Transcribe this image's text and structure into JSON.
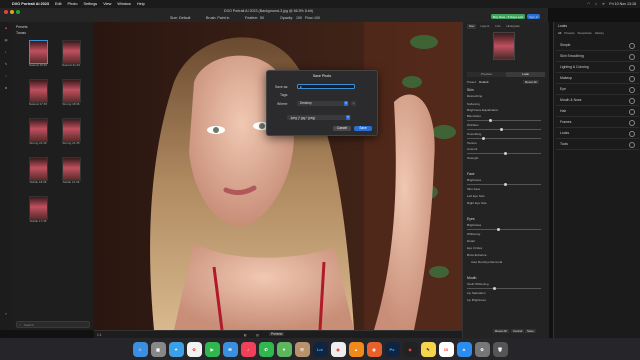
{
  "menubar": {
    "app": "DXO Portrait AI 2023",
    "items": [
      "Edit",
      "Photo",
      "Settings",
      "View",
      "Window",
      "Help"
    ],
    "clock": "Fri 10 Nov 13:18"
  },
  "toolbar": {
    "window_title": "DXO Portrait AI 2023 (Background-3.jpg @ 66.5% 8-bit)",
    "size_label": "Size: Default",
    "brush_label": "Brush: Paint in",
    "feather_label": "Feather:",
    "feather_value": "50",
    "opacity_label": "Opacity:",
    "opacity_value": "100",
    "flow_label": "Flow:",
    "flow_value": "100",
    "buy_label": "Buy Now - 5 Days Left",
    "signin_label": "Sign In"
  },
  "browser": {
    "folder_label": "Presets",
    "subfolder_label": "Tomas",
    "thumbs": [
      {
        "label": "Natural 15:36"
      },
      {
        "label": "Natural 21:46"
      },
      {
        "label": "Natural 17:45"
      },
      {
        "label": "Strong 18:36"
      },
      {
        "label": "Strong 21:46"
      },
      {
        "label": "Strong 21:45"
      },
      {
        "label": "Subtle 18:36"
      },
      {
        "label": "Subtle 21:46"
      },
      {
        "label": "Subtle 17:45"
      }
    ],
    "search_placeholder": "Search"
  },
  "dialog": {
    "title": "Save Photo",
    "save_as_label": "Save as:",
    "save_as_value": "c",
    "tags_label": "Tags:",
    "where_label": "Where:",
    "where_value": "Desktop",
    "format_value": "Jpeg (*.jpg,*.jpeg)",
    "cancel_label": "Cancel",
    "save_label": "Save"
  },
  "right_panel": {
    "tabs": [
      "Nav",
      "Layers",
      "Info",
      "Histogram"
    ],
    "mode_tabs": [
      "Preview",
      "Look"
    ],
    "preset_label": "Preset:",
    "preset_value": "Default",
    "sections": {
      "skin": {
        "title": "Skin",
        "rows": [
          "Retouching",
          "Softening",
          "Brightness Equalization",
          "Blemishes",
          "Wrinkles",
          "Smoothing",
          "Texture",
          "Amount",
          "Strength"
        ]
      },
      "face": {
        "title": "Face",
        "rows": [
          "Brightness",
          "Slim Face",
          "Left Eye Size",
          "Right Eye Size"
        ]
      },
      "eyes": {
        "title": "Eyes",
        "rows": [
          "Brightness",
          "Whitening",
          "Detail",
          "Eye Circles",
          "Brow Enhance",
          "Auto Red Eye Removal"
        ]
      },
      "mouth": {
        "title": "Mouth",
        "rows": [
          "Teeth Whitening",
          "Lip Saturation",
          "Lip Brightness"
        ]
      }
    },
    "reset_all": "Reset All",
    "cancel": "Cancel",
    "save": "Save"
  },
  "presets_panel": {
    "title": "Looks",
    "tabs": [
      "All",
      "Presets",
      "Snapshots",
      "History"
    ],
    "items": [
      "Simple",
      "Skin Smoothing",
      "Lighting & Coloring",
      "Makeup",
      "Eye",
      "Mouth & Nose",
      "Hair",
      "Frames",
      "Looks",
      "Tools"
    ]
  },
  "bottom_bar": {
    "zoom_label": "1:1",
    "preview_label": "Preview"
  },
  "dock": {
    "icons": [
      "finder-icon",
      "launchpad-icon",
      "safari-icon",
      "photos-icon",
      "facetime-icon",
      "mail-icon",
      "music-icon",
      "messages-icon",
      "maps-icon",
      "contacts-icon",
      "lightroom-icon",
      "chrome-icon",
      "vlc-icon",
      "firefox-icon",
      "photoshop-icon",
      "dxo-icon",
      "notes-icon",
      "calendar-icon",
      "appstore-icon",
      "settings-icon",
      "trash-icon"
    ]
  },
  "colors": {
    "accent": "#2a6fd6",
    "buy": "#3da35d"
  }
}
